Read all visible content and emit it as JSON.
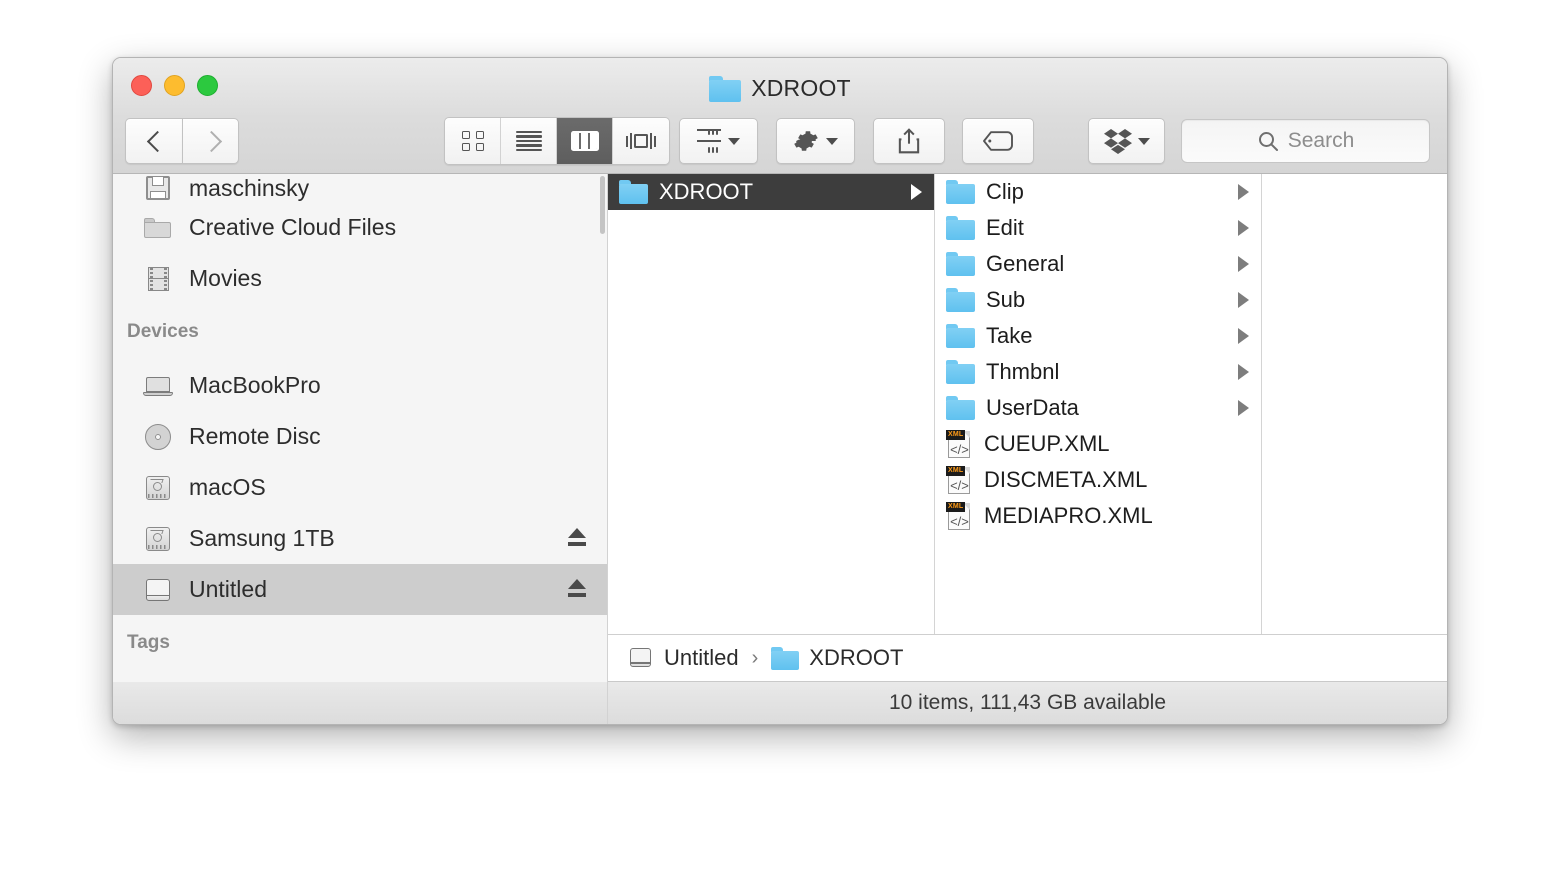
{
  "window": {
    "title": "XDROOT",
    "title_icon": "folder-icon",
    "traffic_lights": {
      "close_label": "close",
      "minimize_label": "minimize",
      "maximize_label": "maximize",
      "close_color": "#fc6058",
      "minimize_color": "#fdbc2f",
      "maximize_color": "#2cc93f"
    }
  },
  "toolbar": {
    "back_label": "Back",
    "forward_label": "Forward",
    "view_buttons": [
      {
        "name": "icon-view",
        "icon": "grid-icon",
        "active": false
      },
      {
        "name": "list-view",
        "icon": "list-icon",
        "active": false
      },
      {
        "name": "column-view",
        "icon": "columns-icon",
        "active": true
      },
      {
        "name": "gallery-view",
        "icon": "coverflow-icon",
        "active": false
      }
    ],
    "arrange_label": "Arrange",
    "arrange_icon": "arrange-icon",
    "action_label": "Action",
    "action_icon": "gear-icon",
    "share_label": "Share",
    "share_icon": "share-icon",
    "tags_label": "Tags",
    "tags_icon": "tag-icon",
    "dropbox_label": "Dropbox",
    "dropbox_icon": "dropbox-icon"
  },
  "search": {
    "placeholder": "Search",
    "value": "",
    "icon": "search-icon"
  },
  "sidebar": {
    "favorites_visible": [
      {
        "label": "maschinsky",
        "icon": "save-icon",
        "clipped": true
      },
      {
        "label": "Creative Cloud Files",
        "icon": "folder-grey-icon",
        "clipped": false
      },
      {
        "label": "Movies",
        "icon": "film-icon",
        "clipped": false
      }
    ],
    "devices_header": "Devices",
    "devices": [
      {
        "label": "MacBookPro",
        "icon": "laptop-icon",
        "eject": false,
        "selected": false
      },
      {
        "label": "Remote Disc",
        "icon": "disc-icon",
        "eject": false,
        "selected": false
      },
      {
        "label": "macOS",
        "icon": "harddrive-icon",
        "eject": false,
        "selected": false
      },
      {
        "label": "Samsung 1TB",
        "icon": "harddrive-icon",
        "eject": true,
        "selected": false
      },
      {
        "label": "Untitled",
        "icon": "external-drive-icon",
        "eject": true,
        "selected": true
      }
    ],
    "tags_header": "Tags"
  },
  "columns": {
    "col1": [
      {
        "label": "XDROOT",
        "icon": "folder-icon",
        "selected": true,
        "has_children": true
      }
    ],
    "col2": [
      {
        "label": "Clip",
        "icon": "folder-icon",
        "selected": false,
        "has_children": true
      },
      {
        "label": "Edit",
        "icon": "folder-icon",
        "selected": false,
        "has_children": true
      },
      {
        "label": "General",
        "icon": "folder-icon",
        "selected": false,
        "has_children": true
      },
      {
        "label": "Sub",
        "icon": "folder-icon",
        "selected": false,
        "has_children": true
      },
      {
        "label": "Take",
        "icon": "folder-icon",
        "selected": false,
        "has_children": true
      },
      {
        "label": "Thmbnl",
        "icon": "folder-icon",
        "selected": false,
        "has_children": true
      },
      {
        "label": "UserData",
        "icon": "folder-icon",
        "selected": false,
        "has_children": true
      },
      {
        "label": "CUEUP.XML",
        "icon": "xml-file-icon",
        "selected": false,
        "has_children": false
      },
      {
        "label": "DISCMETA.XML",
        "icon": "xml-file-icon",
        "selected": false,
        "has_children": false
      },
      {
        "label": "MEDIAPRO.XML",
        "icon": "xml-file-icon",
        "selected": false,
        "has_children": false
      }
    ],
    "col3": []
  },
  "pathbar": {
    "crumbs": [
      {
        "label": "Untitled",
        "icon": "external-drive-icon"
      },
      {
        "label": "XDROOT",
        "icon": "folder-icon"
      }
    ],
    "separator": "›"
  },
  "statusbar": {
    "text": "10 items, 111,43 GB available"
  },
  "colors": {
    "folder_blue": "#5fc1ef",
    "selection_dark": "#3d3d3d",
    "sidebar_selection": "#cdcdcd",
    "xml_badge_orange": "#ff9b17"
  }
}
